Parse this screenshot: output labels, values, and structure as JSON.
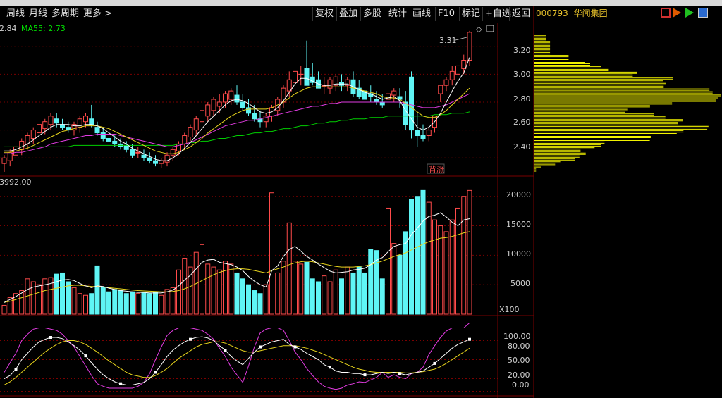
{
  "toolbar": {
    "left_items": [
      "周线",
      "月线",
      "多周期",
      "更多 >"
    ],
    "right_items": [
      "复权",
      "叠加",
      "多股",
      "统计",
      "画线",
      "F10",
      "标记",
      "+自选",
      "返回"
    ]
  },
  "stock": {
    "code": "000793",
    "name": "华闻集团"
  },
  "main_panel": {
    "ma_labels": [
      {
        "text": "2.84",
        "color": "#ffffff"
      },
      {
        "text": "MA55: 2.73",
        "color": "#00e000"
      }
    ],
    "y_ticks": [
      "3.20",
      "3.00",
      "2.80",
      "2.60",
      "2.40"
    ],
    "high_label": "3.31",
    "marker_text": "背涨"
  },
  "volume_panel": {
    "header": "3992.00",
    "y_ticks": [
      "20000",
      "15000",
      "10000",
      "5000"
    ],
    "unit": "X100"
  },
  "kdj_panel": {
    "y_ticks": [
      "100.00",
      "80.00",
      "50.00",
      "20.00",
      "0.00"
    ]
  },
  "colors": {
    "up": "#ff4a4a",
    "down": "#5ff5f5",
    "ma_white": "#ffffff",
    "ma_yellow": "#e6d31c",
    "ma_magenta": "#e23ce2",
    "ma_green": "#00d000",
    "grid": "#7a0000",
    "profile": "#f2f200"
  },
  "chart_data": [
    {
      "type": "candlestick",
      "ylim": [
        2.28,
        3.36
      ],
      "y_ticks": [
        3.2,
        3.0,
        2.8,
        2.6,
        2.4
      ],
      "open": [
        2.36,
        2.38,
        2.42,
        2.46,
        2.5,
        2.54,
        2.58,
        2.61,
        2.64,
        2.68,
        2.64,
        2.62,
        2.6,
        2.62,
        2.66,
        2.68,
        2.62,
        2.58,
        2.54,
        2.52,
        2.5,
        2.49,
        2.46,
        2.44,
        2.42,
        2.4,
        2.38,
        2.36,
        2.37,
        2.42,
        2.45,
        2.5,
        2.55,
        2.6,
        2.66,
        2.7,
        2.74,
        2.77,
        2.8,
        2.82,
        2.85,
        2.8,
        2.76,
        2.72,
        2.68,
        2.66,
        2.7,
        2.74,
        2.8,
        2.88,
        2.94,
        3.0,
        3.04,
        2.98,
        2.96,
        2.92,
        2.9,
        2.92,
        2.94,
        2.92,
        2.96,
        2.9,
        2.88,
        2.86,
        2.82,
        2.8,
        2.82,
        2.85,
        2.84,
        2.8,
        2.98,
        2.6,
        2.56,
        2.56,
        2.62,
        2.86,
        2.92,
        2.96,
        3.0,
        3.04,
        3.1
      ],
      "high": [
        2.42,
        2.46,
        2.5,
        2.54,
        2.58,
        2.62,
        2.66,
        2.68,
        2.72,
        2.72,
        2.68,
        2.66,
        2.66,
        2.7,
        2.72,
        2.78,
        2.66,
        2.62,
        2.58,
        2.56,
        2.54,
        2.52,
        2.5,
        2.48,
        2.46,
        2.44,
        2.42,
        2.4,
        2.44,
        2.48,
        2.52,
        2.58,
        2.64,
        2.7,
        2.76,
        2.8,
        2.84,
        2.86,
        2.88,
        2.9,
        2.92,
        2.86,
        2.82,
        2.78,
        2.74,
        2.72,
        2.78,
        2.84,
        2.92,
        3.02,
        3.04,
        3.06,
        3.24,
        3.08,
        3.02,
        2.98,
        2.98,
        3.0,
        3.0,
        2.98,
        3.02,
        2.96,
        2.94,
        2.92,
        2.88,
        2.86,
        2.88,
        2.9,
        2.9,
        2.88,
        3.02,
        2.72,
        2.64,
        2.62,
        2.7,
        2.9,
        2.98,
        3.06,
        3.1,
        3.14,
        3.31
      ],
      "low": [
        2.3,
        2.34,
        2.38,
        2.42,
        2.46,
        2.5,
        2.54,
        2.57,
        2.6,
        2.62,
        2.6,
        2.58,
        2.56,
        2.58,
        2.62,
        2.62,
        2.56,
        2.52,
        2.5,
        2.48,
        2.46,
        2.44,
        2.4,
        2.4,
        2.38,
        2.36,
        2.34,
        2.33,
        2.34,
        2.38,
        2.42,
        2.46,
        2.52,
        2.56,
        2.62,
        2.66,
        2.7,
        2.72,
        2.76,
        2.78,
        2.78,
        2.74,
        2.7,
        2.66,
        2.62,
        2.62,
        2.66,
        2.7,
        2.76,
        2.84,
        2.88,
        2.92,
        2.94,
        2.92,
        2.9,
        2.86,
        2.86,
        2.88,
        2.88,
        2.88,
        2.84,
        2.82,
        2.8,
        2.8,
        2.78,
        2.76,
        2.78,
        2.8,
        2.76,
        2.6,
        2.54,
        2.48,
        2.52,
        2.52,
        2.58,
        2.8,
        2.88,
        2.92,
        2.96,
        3.0,
        3.06
      ],
      "close": [
        2.4,
        2.44,
        2.48,
        2.52,
        2.56,
        2.6,
        2.64,
        2.66,
        2.7,
        2.65,
        2.62,
        2.6,
        2.64,
        2.68,
        2.7,
        2.64,
        2.58,
        2.54,
        2.52,
        2.5,
        2.48,
        2.46,
        2.42,
        2.44,
        2.4,
        2.38,
        2.36,
        2.38,
        2.42,
        2.46,
        2.5,
        2.56,
        2.62,
        2.68,
        2.74,
        2.78,
        2.82,
        2.8,
        2.86,
        2.88,
        2.8,
        2.76,
        2.72,
        2.68,
        2.66,
        2.7,
        2.76,
        2.82,
        2.9,
        2.96,
        3.02,
        3.0,
        2.92,
        2.94,
        2.9,
        2.92,
        2.96,
        2.98,
        2.92,
        2.96,
        2.86,
        2.84,
        2.82,
        2.84,
        2.8,
        2.78,
        2.86,
        2.88,
        2.82,
        2.64,
        2.6,
        2.56,
        2.54,
        2.6,
        2.7,
        2.92,
        2.96,
        3.02,
        3.06,
        3.1,
        3.3
      ],
      "ma_white": [
        2.45,
        2.45,
        2.46,
        2.48,
        2.5,
        2.53,
        2.56,
        2.59,
        2.62,
        2.64,
        2.64,
        2.64,
        2.63,
        2.63,
        2.64,
        2.64,
        2.63,
        2.61,
        2.58,
        2.55,
        2.52,
        2.5,
        2.47,
        2.45,
        2.43,
        2.41,
        2.39,
        2.38,
        2.38,
        2.4,
        2.43,
        2.47,
        2.51,
        2.56,
        2.61,
        2.66,
        2.7,
        2.74,
        2.78,
        2.81,
        2.82,
        2.81,
        2.79,
        2.76,
        2.73,
        2.72,
        2.73,
        2.76,
        2.81,
        2.87,
        2.93,
        2.97,
        2.97,
        2.95,
        2.93,
        2.92,
        2.92,
        2.93,
        2.93,
        2.93,
        2.91,
        2.89,
        2.87,
        2.86,
        2.84,
        2.82,
        2.83,
        2.84,
        2.81,
        2.74,
        2.68,
        2.62,
        2.6,
        2.62,
        2.66,
        2.72,
        2.8,
        2.88,
        2.95,
        3.01,
        3.12
      ],
      "ma_yellow": [
        2.44,
        2.44,
        2.45,
        2.46,
        2.47,
        2.49,
        2.51,
        2.53,
        2.55,
        2.57,
        2.59,
        2.6,
        2.61,
        2.62,
        2.63,
        2.63,
        2.63,
        2.62,
        2.61,
        2.59,
        2.57,
        2.55,
        2.53,
        2.51,
        2.49,
        2.47,
        2.45,
        2.44,
        2.43,
        2.43,
        2.44,
        2.46,
        2.48,
        2.51,
        2.54,
        2.58,
        2.61,
        2.64,
        2.67,
        2.7,
        2.72,
        2.74,
        2.75,
        2.75,
        2.75,
        2.75,
        2.76,
        2.78,
        2.8,
        2.83,
        2.86,
        2.88,
        2.9,
        2.91,
        2.91,
        2.91,
        2.91,
        2.91,
        2.91,
        2.91,
        2.9,
        2.89,
        2.88,
        2.87,
        2.86,
        2.84,
        2.83,
        2.83,
        2.82,
        2.79,
        2.76,
        2.73,
        2.7,
        2.69,
        2.69,
        2.71,
        2.74,
        2.78,
        2.82,
        2.86,
        2.9
      ],
      "ma_magenta": [
        2.43,
        2.43,
        2.44,
        2.44,
        2.45,
        2.46,
        2.47,
        2.48,
        2.5,
        2.51,
        2.52,
        2.53,
        2.54,
        2.55,
        2.56,
        2.56,
        2.57,
        2.57,
        2.57,
        2.57,
        2.56,
        2.55,
        2.54,
        2.53,
        2.52,
        2.51,
        2.5,
        2.49,
        2.48,
        2.48,
        2.49,
        2.5,
        2.51,
        2.53,
        2.55,
        2.57,
        2.59,
        2.61,
        2.63,
        2.64,
        2.65,
        2.66,
        2.67,
        2.67,
        2.68,
        2.69,
        2.7,
        2.71,
        2.72,
        2.73,
        2.74,
        2.75,
        2.76,
        2.77,
        2.77,
        2.78,
        2.79,
        2.79,
        2.8,
        2.8,
        2.8,
        2.8,
        2.8,
        2.8,
        2.8,
        2.8,
        2.8,
        2.8,
        2.8,
        2.79,
        2.78,
        2.77,
        2.76,
        2.76,
        2.76,
        2.77,
        2.78,
        2.8,
        2.82,
        2.84,
        2.86
      ],
      "ma_green": [
        2.48,
        2.48,
        2.48,
        2.48,
        2.48,
        2.48,
        2.48,
        2.48,
        2.48,
        2.48,
        2.48,
        2.48,
        2.49,
        2.49,
        2.49,
        2.49,
        2.49,
        2.49,
        2.49,
        2.49,
        2.49,
        2.49,
        2.49,
        2.49,
        2.49,
        2.49,
        2.49,
        2.49,
        2.49,
        2.49,
        2.5,
        2.5,
        2.51,
        2.51,
        2.52,
        2.52,
        2.53,
        2.54,
        2.54,
        2.55,
        2.56,
        2.56,
        2.57,
        2.58,
        2.58,
        2.59,
        2.59,
        2.6,
        2.61,
        2.61,
        2.62,
        2.63,
        2.63,
        2.64,
        2.65,
        2.65,
        2.66,
        2.66,
        2.67,
        2.67,
        2.68,
        2.68,
        2.68,
        2.69,
        2.69,
        2.69,
        2.7,
        2.7,
        2.7,
        2.7,
        2.7,
        2.7,
        2.7,
        2.7,
        2.71,
        2.71,
        2.71,
        2.72,
        2.72,
        2.72,
        2.73
      ]
    },
    {
      "type": "bar",
      "ylim": [
        0,
        22000
      ],
      "y_ticks": [
        20000,
        15000,
        10000,
        5000
      ],
      "volume": [
        1500,
        2800,
        3500,
        4000,
        6000,
        5500,
        5000,
        6000,
        6200,
        6800,
        7000,
        5500,
        4500,
        3500,
        3200,
        3500,
        8200,
        4500,
        3800,
        4200,
        4000,
        3500,
        3800,
        3500,
        3600,
        3500,
        3800,
        3200,
        4200,
        4500,
        7500,
        9500,
        8000,
        10500,
        11800,
        8500,
        8000,
        7500,
        9000,
        8500,
        7000,
        6000,
        5000,
        4000,
        3500,
        5000,
        20600,
        7000,
        9000,
        15500,
        9000,
        8500,
        8800,
        6000,
        5500,
        6500,
        5500,
        7500,
        6000,
        8000,
        7000,
        8000,
        7000,
        11000,
        10800,
        6000,
        18000,
        12000,
        10000,
        14000,
        19500,
        20000,
        21000,
        19000,
        16000,
        15000,
        14000,
        16000,
        18000,
        20000,
        21000
      ],
      "ma_white": [
        2000,
        2500,
        3000,
        3600,
        4200,
        4600,
        4800,
        5000,
        5200,
        5500,
        5800,
        5900,
        5700,
        5200,
        4800,
        4500,
        4800,
        4700,
        4400,
        4200,
        4000,
        3900,
        3800,
        3700,
        3700,
        3600,
        3600,
        3600,
        3800,
        4100,
        4800,
        5800,
        6600,
        7700,
        8800,
        9200,
        9300,
        8800,
        8600,
        8400,
        8000,
        7400,
        6400,
        5600,
        5000,
        4600,
        7400,
        8200,
        9800,
        11000,
        11500,
        10700,
        9800,
        9200,
        8500,
        7900,
        7300,
        7000,
        7100,
        7200,
        7500,
        7600,
        7800,
        8400,
        9200,
        9600,
        10600,
        11500,
        11800,
        12000,
        13500,
        14600,
        15800,
        16600,
        16800,
        17200,
        16500,
        15600,
        15000,
        16000,
        16200
      ],
      "ma_yellow": [
        2000,
        2200,
        2500,
        2800,
        3100,
        3400,
        3700,
        4000,
        4200,
        4400,
        4600,
        4800,
        4900,
        4900,
        4800,
        4700,
        4700,
        4600,
        4500,
        4400,
        4300,
        4200,
        4100,
        4000,
        3950,
        3900,
        3850,
        3800,
        3800,
        3850,
        4000,
        4300,
        4700,
        5200,
        5700,
        6200,
        6700,
        7100,
        7400,
        7600,
        7700,
        7700,
        7600,
        7400,
        7200,
        7000,
        7400,
        7700,
        8000,
        8400,
        8700,
        8900,
        9000,
        8900,
        8700,
        8500,
        8300,
        8100,
        8000,
        8000,
        8000,
        8100,
        8200,
        8400,
        8700,
        9000,
        9400,
        9800,
        10100,
        10400,
        10900,
        11400,
        11900,
        12300,
        12600,
        12900,
        13000,
        13200,
        13500,
        13800,
        14000
      ]
    },
    {
      "type": "line",
      "ylim": [
        -5,
        115
      ],
      "y_ticks": [
        100,
        80,
        50,
        20,
        0
      ],
      "k_white": [
        20,
        25,
        35,
        50,
        60,
        70,
        78,
        82,
        85,
        85,
        83,
        78,
        72,
        65,
        56,
        45,
        35,
        26,
        20,
        15,
        12,
        10,
        10,
        12,
        14,
        20,
        30,
        42,
        55,
        65,
        72,
        78,
        82,
        85,
        86,
        84,
        80,
        72,
        65,
        55,
        48,
        42,
        52,
        62,
        70,
        74,
        78,
        80,
        82,
        74,
        70,
        66,
        60,
        55,
        50,
        42,
        38,
        32,
        30,
        30,
        28,
        28,
        26,
        26,
        28,
        30,
        28,
        30,
        28,
        26,
        28,
        30,
        32,
        38,
        44,
        52,
        60,
        68,
        74,
        78,
        82
      ],
      "d_yellow": [
        10,
        15,
        22,
        30,
        38,
        46,
        54,
        62,
        68,
        74,
        78,
        80,
        80,
        78,
        74,
        68,
        62,
        55,
        48,
        42,
        36,
        30,
        26,
        24,
        22,
        22,
        25,
        30,
        36,
        44,
        52,
        58,
        64,
        70,
        74,
        76,
        78,
        78,
        76,
        72,
        68,
        64,
        62,
        62,
        64,
        66,
        68,
        70,
        72,
        72,
        72,
        70,
        68,
        65,
        62,
        58,
        54,
        50,
        46,
        42,
        38,
        35,
        33,
        31,
        30,
        30,
        30,
        30,
        30,
        29,
        29,
        30,
        31,
        33,
        35,
        39,
        44,
        50,
        56,
        62,
        68
      ],
      "j_magenta": [
        30,
        45,
        60,
        80,
        90,
        98,
        100,
        100,
        98,
        96,
        90,
        80,
        70,
        55,
        40,
        25,
        12,
        8,
        5,
        5,
        5,
        5,
        5,
        8,
        14,
        28,
        50,
        70,
        88,
        96,
        100,
        100,
        100,
        98,
        96,
        90,
        82,
        68,
        55,
        38,
        26,
        14,
        40,
        70,
        92,
        98,
        100,
        100,
        96,
        80,
        62,
        50,
        36,
        25,
        15,
        8,
        5,
        3,
        5,
        10,
        12,
        15,
        14,
        18,
        22,
        30,
        22,
        26,
        22,
        20,
        28,
        30,
        38,
        58,
        72,
        85,
        95,
        100,
        100,
        100,
        108
      ]
    }
  ]
}
